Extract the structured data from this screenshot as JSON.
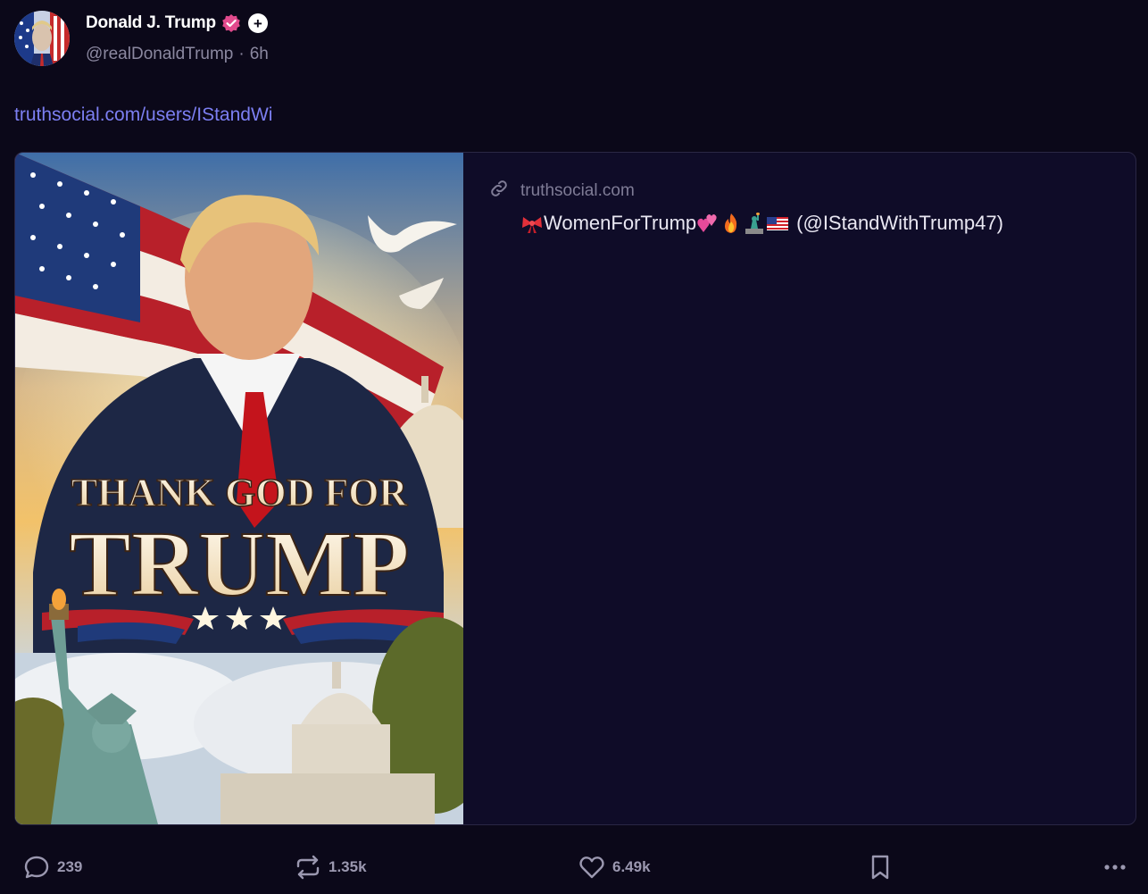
{
  "author": {
    "name": "Donald J. Trump",
    "handle": "@realDonaldTrump",
    "separator": "·",
    "time": "6h",
    "plus_badge": "+"
  },
  "post": {
    "link_text": "truthsocial.com/users/IStandWi"
  },
  "card": {
    "domain": "truthsocial.com",
    "title_text": "WomenForTrump",
    "title_handle": "(@IStandWithTrump47)",
    "image_text": {
      "line1": "THANK GOD FOR",
      "line2": "TRUMP"
    }
  },
  "actions": {
    "reply_count": "239",
    "repost_count": "1.35k",
    "like_count": "6.49k"
  },
  "colors": {
    "background": "#0b0819",
    "card_background": "#0f0c28",
    "link": "#7c7ff2",
    "verified": "#e24a8d",
    "muted": "#8b88a0"
  },
  "icons": [
    "verified-icon",
    "plus-icon",
    "link-icon",
    "ribbon-emoji",
    "hearts-emoji",
    "fire-emoji",
    "statue-of-liberty-emoji",
    "us-flag-emoji",
    "reply-icon",
    "repost-icon",
    "like-icon",
    "bookmark-icon",
    "more-icon"
  ]
}
